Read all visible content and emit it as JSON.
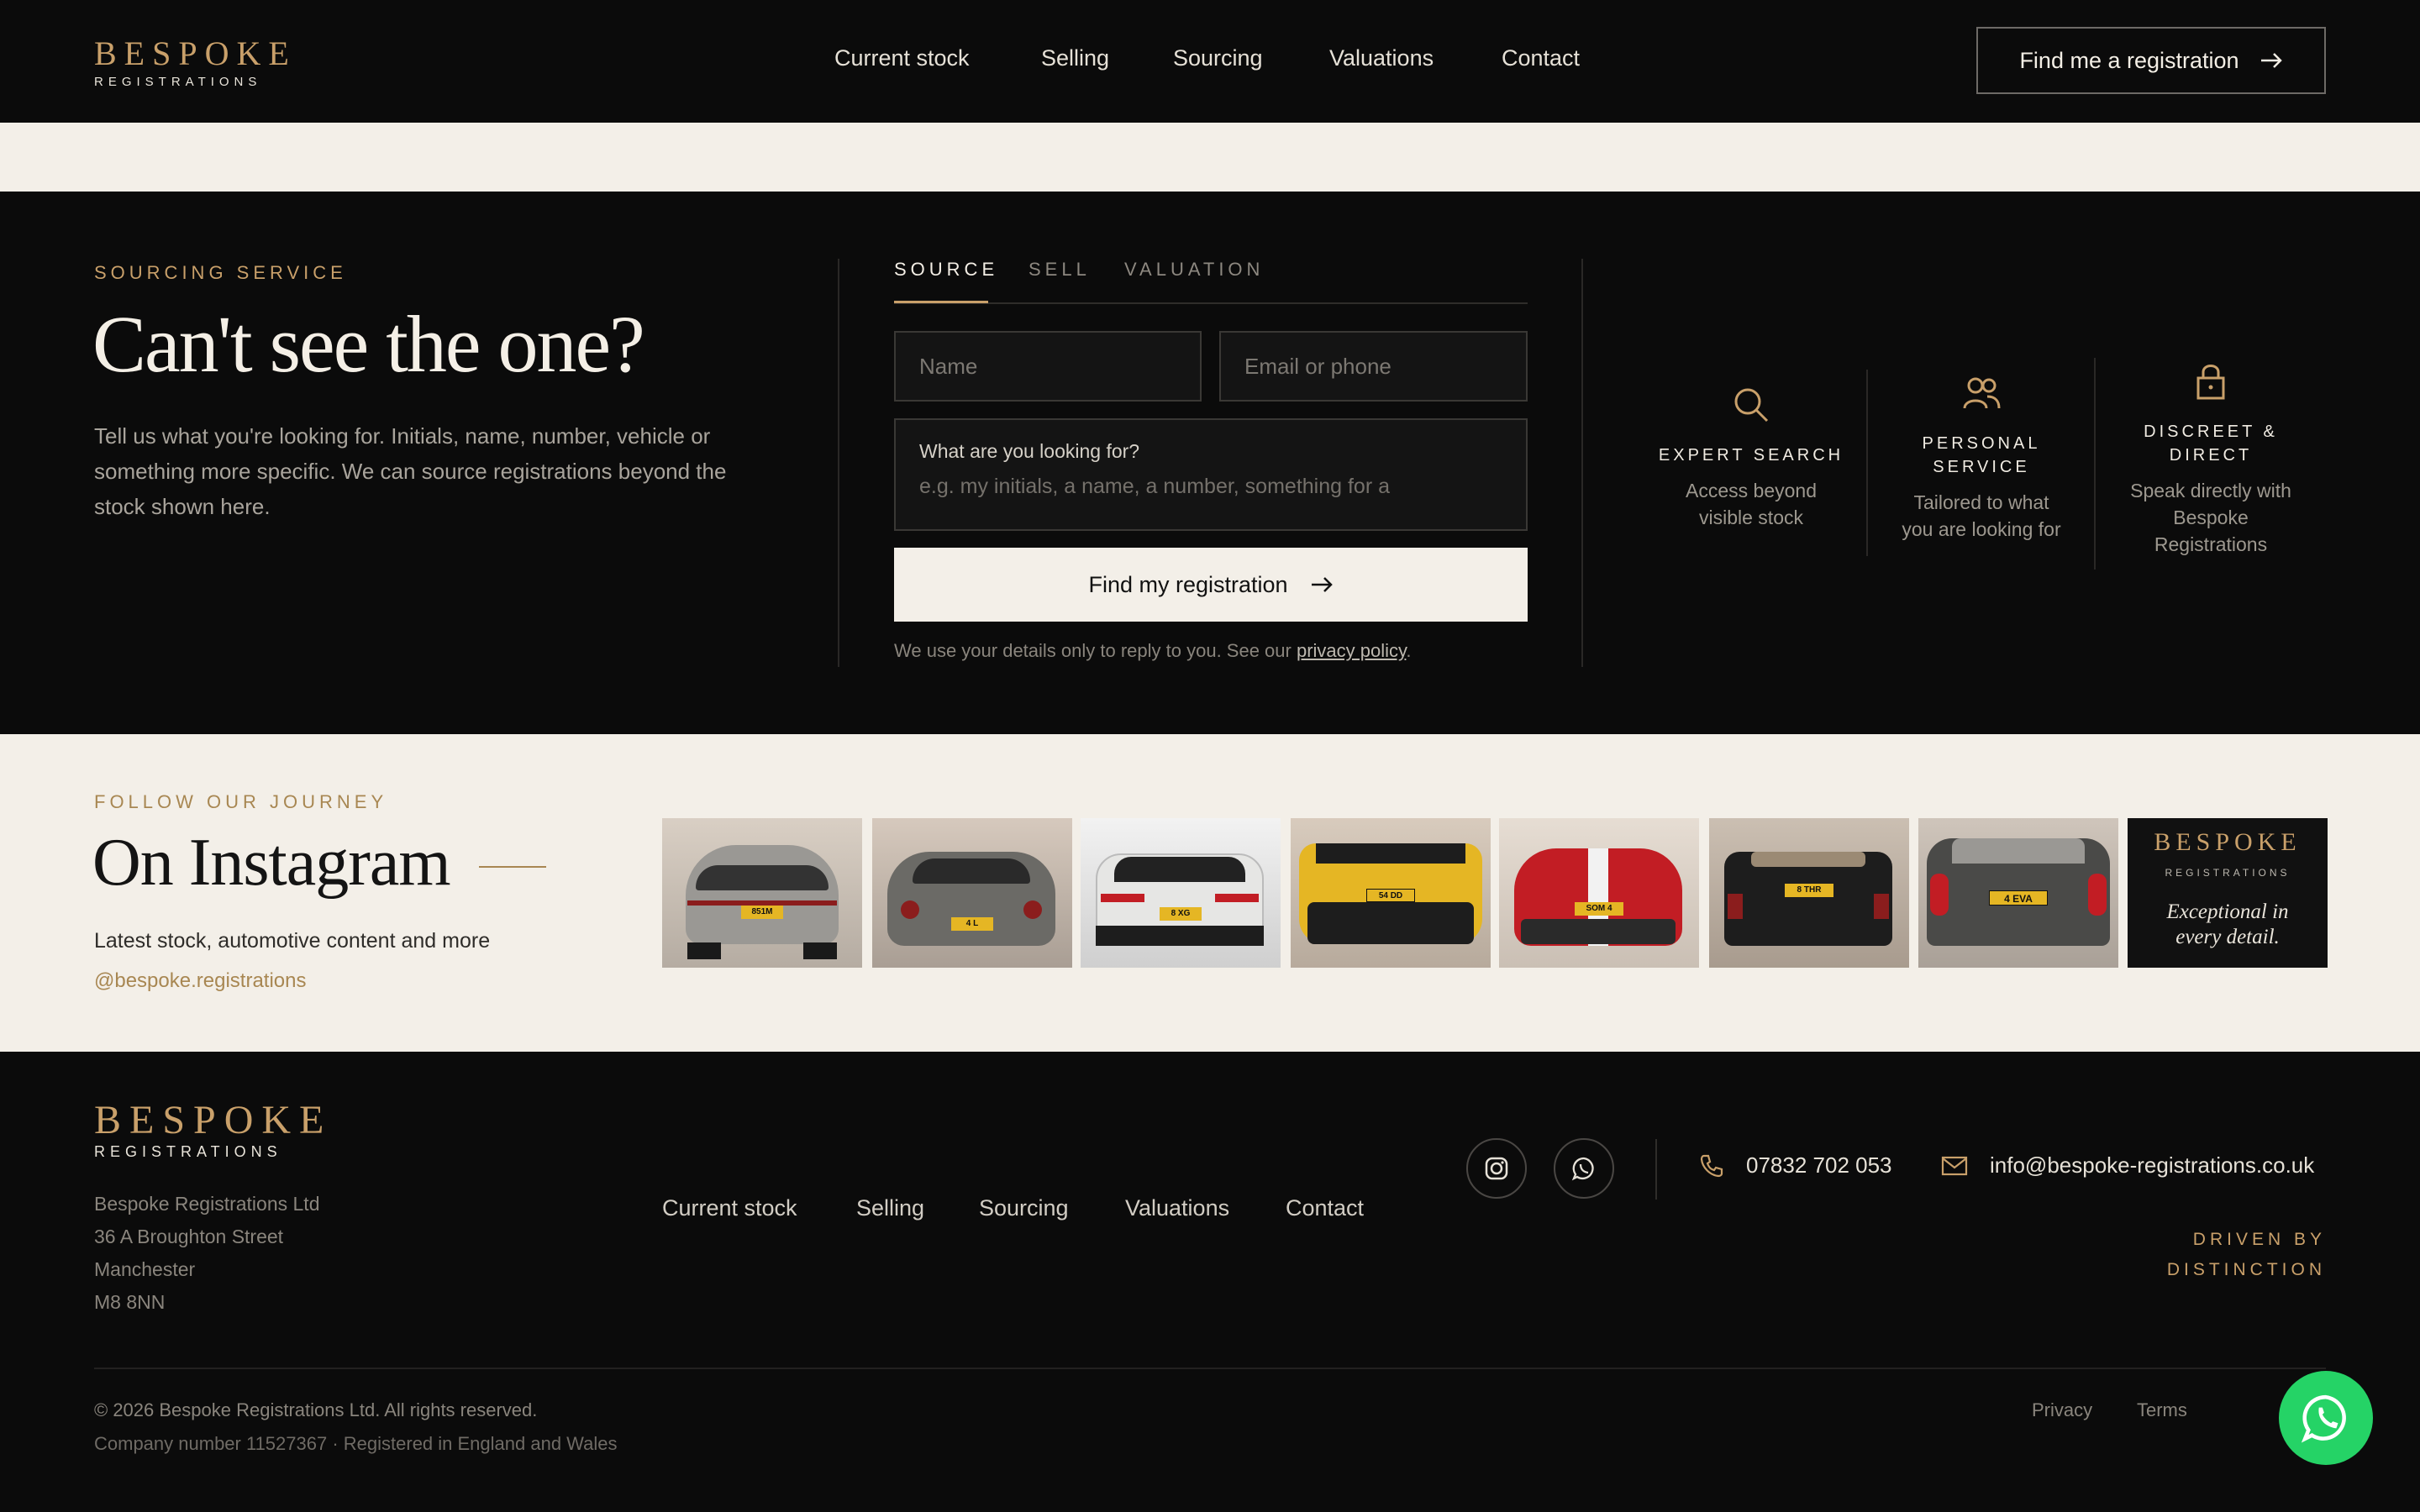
{
  "header": {
    "logo_word": "BESPOKE",
    "logo_sub": "REGISTRATIONS",
    "nav": [
      "Current stock",
      "Selling",
      "Sourcing",
      "Valuations",
      "Contact"
    ],
    "cta_label": "Find me a registration"
  },
  "sourcing": {
    "eyebrow": "SOURCING SERVICE",
    "title": "Can't see the one?",
    "description": "Tell us what you're looking for. Initials, name, number, vehicle or something more specific. We can source registrations beyond the stock shown here.",
    "tabs": [
      "SOURCE",
      "SELL",
      "VALUATION"
    ],
    "active_tab": "SOURCE",
    "name_placeholder": "Name",
    "contact_placeholder": "Email or phone",
    "looking_label": "What are you looking for?",
    "looking_placeholder": "e.g. my initials, a name, a number, something for a",
    "submit_label": "Find my registration",
    "privacy_prefix": "We use your details only to reply to you. See our ",
    "privacy_link": "privacy policy",
    "privacy_suffix": ".",
    "features": [
      {
        "icon": "search-icon",
        "title_1": "EXPERT SEARCH",
        "title_2": "",
        "text": [
          "Access beyond",
          "visible stock"
        ]
      },
      {
        "icon": "people-icon",
        "title_1": "PERSONAL",
        "title_2": "SERVICE",
        "text": [
          "Tailored to what",
          "you are looking for"
        ]
      },
      {
        "icon": "lock-icon",
        "title_1": "DISCREET &",
        "title_2": "DIRECT",
        "text": [
          "Speak directly with",
          "Bespoke",
          "Registrations"
        ]
      }
    ]
  },
  "instagram": {
    "eyebrow": "FOLLOW OUR JOURNEY",
    "title": "On Instagram",
    "subtitle": "Latest stock, automotive content and more",
    "handle": "@bespoke.registrations",
    "plates": [
      "851M",
      "4 L",
      "8 XG",
      "54 DD",
      "SOM 4",
      "8 THR",
      "4 EVA"
    ],
    "brand_tile": {
      "word": "BESPOKE",
      "sub": "REGISTRATIONS",
      "tagline_1": "Exceptional in",
      "tagline_2": "every detail."
    },
    "colors": {
      "silver": "#9a9894",
      "grey": "#6b6a66",
      "white": "#e6e6e4",
      "yellow": "#e5b624",
      "red": "#c21d24",
      "black": "#1d1d1d",
      "dark_grey": "#4a4a48"
    }
  },
  "footer": {
    "logo_word": "BESPOKE",
    "logo_sub": "REGISTRATIONS",
    "address": [
      "Bespoke Registrations Ltd",
      "36 A Broughton Street",
      "Manchester",
      "M8 8NN"
    ],
    "nav": [
      "Current stock",
      "Selling",
      "Sourcing",
      "Valuations",
      "Contact"
    ],
    "phone": "07832 702 053",
    "email": "info@bespoke-registrations.co.uk",
    "tagline_1": "DRIVEN BY",
    "tagline_2": "DISTINCTION",
    "copyright": "© 2026 Bespoke Registrations Ltd. All rights reserved.",
    "company": "Company number 11527367 · Registered in England and Wales",
    "legal": [
      "Privacy",
      "Terms"
    ]
  },
  "accent_color": "#c9a06a",
  "whatsapp_color": "#25d366"
}
